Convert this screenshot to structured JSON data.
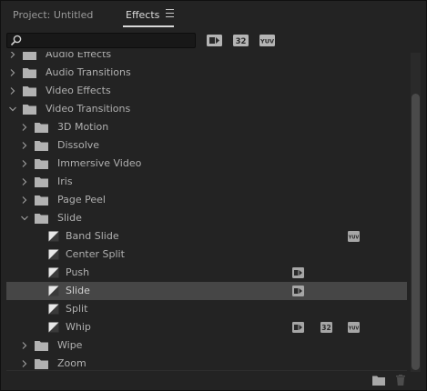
{
  "tabs": {
    "project": "Project: Untitled",
    "effects": "Effects"
  },
  "search": {
    "value": "",
    "placeholder": ""
  },
  "filter_badges": [
    "accelerated-effects-icon",
    "32-bit-color-icon",
    "yuv-icon"
  ],
  "tree": [
    {
      "label": "Audio Effects",
      "depth": 0,
      "type": "folder",
      "expanded": false
    },
    {
      "label": "Audio Transitions",
      "depth": 0,
      "type": "folder",
      "expanded": false
    },
    {
      "label": "Video Effects",
      "depth": 0,
      "type": "folder",
      "expanded": false
    },
    {
      "label": "Video Transitions",
      "depth": 0,
      "type": "folder",
      "expanded": true
    },
    {
      "label": "3D Motion",
      "depth": 1,
      "type": "folder",
      "expanded": false
    },
    {
      "label": "Dissolve",
      "depth": 1,
      "type": "folder",
      "expanded": false
    },
    {
      "label": "Immersive Video",
      "depth": 1,
      "type": "folder",
      "expanded": false
    },
    {
      "label": "Iris",
      "depth": 1,
      "type": "folder",
      "expanded": false
    },
    {
      "label": "Page Peel",
      "depth": 1,
      "type": "folder",
      "expanded": false
    },
    {
      "label": "Slide",
      "depth": 1,
      "type": "folder",
      "expanded": true
    },
    {
      "label": "Band Slide",
      "depth": 2,
      "type": "transition",
      "badges": [
        "yuv"
      ]
    },
    {
      "label": "Center Split",
      "depth": 2,
      "type": "transition",
      "badges": []
    },
    {
      "label": "Push",
      "depth": 2,
      "type": "transition",
      "badges": [
        "accelerated"
      ]
    },
    {
      "label": "Slide",
      "depth": 2,
      "type": "transition",
      "badges": [
        "accelerated"
      ],
      "selected": true
    },
    {
      "label": "Split",
      "depth": 2,
      "type": "transition",
      "badges": []
    },
    {
      "label": "Whip",
      "depth": 2,
      "type": "transition",
      "badges": [
        "accelerated",
        "32bit",
        "yuv"
      ]
    },
    {
      "label": "Wipe",
      "depth": 1,
      "type": "folder",
      "expanded": false
    },
    {
      "label": "Zoom",
      "depth": 1,
      "type": "folder",
      "expanded": false
    }
  ],
  "bottom_actions": [
    "new-bin-icon",
    "delete-icon"
  ],
  "badge_text": {
    "accelerated": "▶",
    "32bit": "32",
    "yuv": "YUV"
  },
  "colors": {
    "panel_bg": "#232323",
    "selected_row": "#464646",
    "text": "#b0b0b0",
    "accent_tab": "#d8d8d8"
  }
}
